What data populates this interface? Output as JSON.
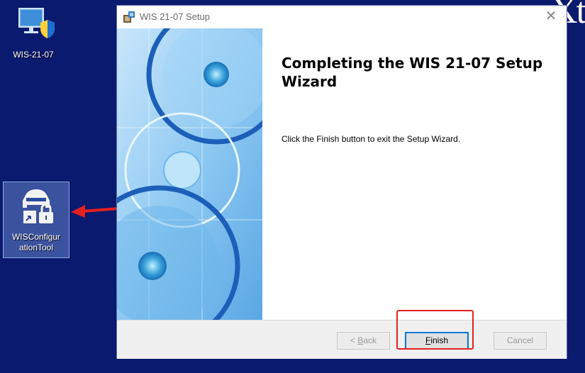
{
  "desktop": {
    "icons": [
      {
        "label": "WIS-21-07"
      },
      {
        "label_line1": "WISConfigur",
        "label_line2": "ationTool"
      }
    ],
    "corner_text": "Xt"
  },
  "dialog": {
    "title": "WIS 21-07 Setup",
    "close_glyph": "✕",
    "heading": "Completing the WIS 21-07 Setup Wizard",
    "message": "Click the Finish button to exit the Setup Wizard.",
    "buttons": {
      "back": {
        "prefix": "< ",
        "mnemonic": "B",
        "rest": "ack"
      },
      "finish": {
        "mnemonic": "F",
        "rest": "inish"
      },
      "cancel": "Cancel"
    }
  },
  "colors": {
    "desktop_bg": "#0a1a6e",
    "highlight": "#e62020",
    "default_button_border": "#0078d7"
  }
}
